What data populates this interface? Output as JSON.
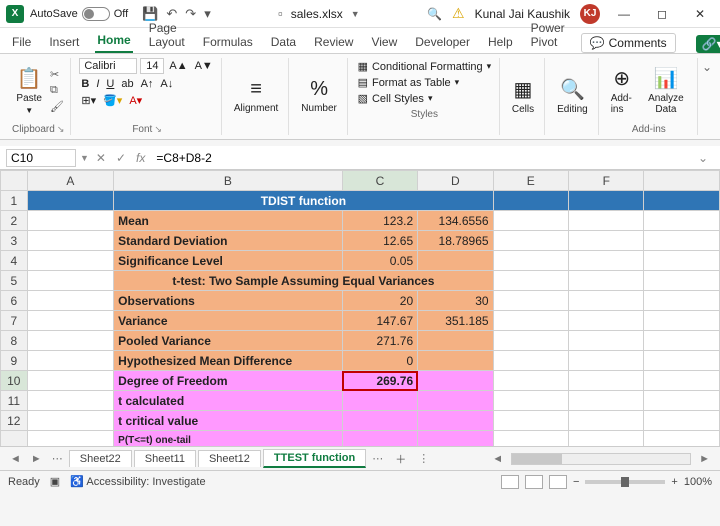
{
  "titlebar": {
    "autosave_label": "AutoSave",
    "autosave_state": "Off",
    "filename": "sales.xlsx",
    "username": "Kunal Jai Kaushik",
    "avatar_initials": "KJ"
  },
  "menu": {
    "file": "File",
    "insert": "Insert",
    "home": "Home",
    "page_layout": "Page Layout",
    "formulas": "Formulas",
    "data": "Data",
    "review": "Review",
    "view": "View",
    "developer": "Developer",
    "help": "Help",
    "power_pivot": "Power Pivot",
    "comments": "Comments"
  },
  "ribbon": {
    "paste": "Paste",
    "clipboard_label": "Clipboard",
    "font_name": "Calibri",
    "font_size": "14",
    "font_label": "Font",
    "alignment": "Alignment",
    "number": "Number",
    "cond_fmt": "Conditional Formatting",
    "fmt_table": "Format as Table",
    "cell_styles": "Cell Styles",
    "styles_label": "Styles",
    "cells": "Cells",
    "editing": "Editing",
    "addins": "Add-ins",
    "analyze": "Analyze Data",
    "addins_label": "Add-ins"
  },
  "formula_bar": {
    "name_box": "C10",
    "formula": "=C8+D8-2"
  },
  "columns": [
    "A",
    "B",
    "C",
    "D",
    "E",
    "F"
  ],
  "rows": {
    "r1_title": "TDIST function",
    "r2_label": "Mean",
    "r2_c": "123.2",
    "r2_d": "134.6556",
    "r3_label": "Standard Deviation",
    "r3_c": "12.65",
    "r3_d": "18.78965",
    "r4_label": "Significance Level",
    "r4_c": "0.05",
    "r5_title": "t-test: Two Sample Assuming Equal Variances",
    "r6_label": "Observations",
    "r6_c": "20",
    "r6_d": "30",
    "r7_label": "Variance",
    "r7_c": "147.67",
    "r7_d": "351.185",
    "r8_label": "Pooled Variance",
    "r8_c": "271.76",
    "r9_label": "Hypothesized Mean Difference",
    "r9_c": "0",
    "r10_label": "Degree of Freedom",
    "r10_c": "269.76",
    "r11_label": "t calculated",
    "r12_label": "t critical value",
    "r13_label": "P(T<=t) one-tail"
  },
  "sheets": {
    "s1": "Sheet22",
    "s2": "Sheet11",
    "s3": "Sheet12",
    "s4": "TTEST function"
  },
  "status": {
    "ready": "Ready",
    "acc": "Accessibility: Investigate",
    "zoom": "100%"
  }
}
